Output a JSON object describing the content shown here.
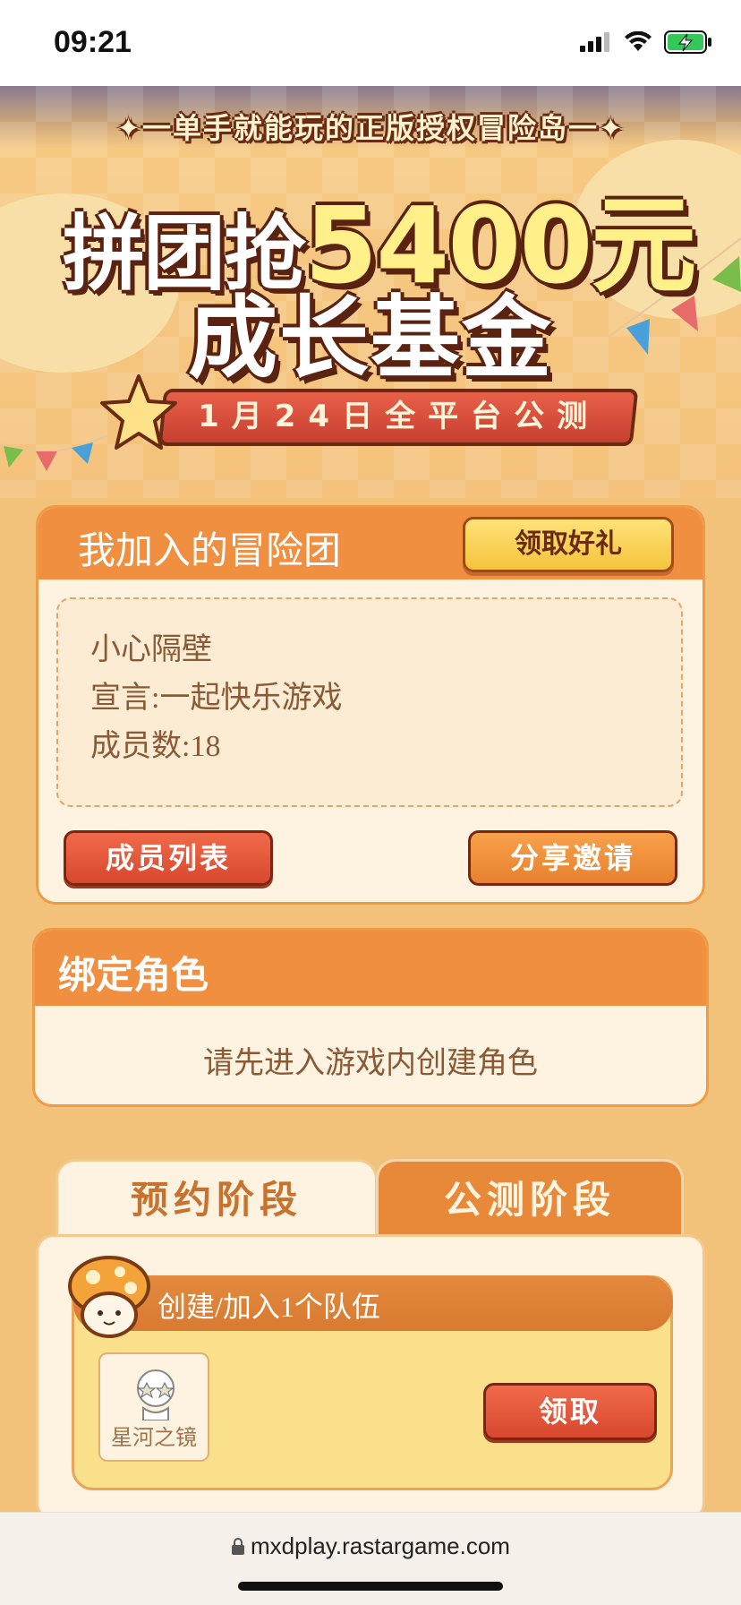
{
  "status_bar": {
    "time": "09:21"
  },
  "hero": {
    "tagline": "✦一单手就能玩的正版授权冒险岛一✦",
    "headline_part1": "拼团抢",
    "headline_part2": "5400元",
    "headline_line2": "成长基金",
    "date_ribbon": "1月24日全平台公测"
  },
  "my_team": {
    "title": "我加入的冒险团",
    "claim_button": "领取好礼",
    "team_name": "小心隔壁",
    "motto": "宣言:一起快乐游戏",
    "members": "成员数:18",
    "member_list_button": "成员列表",
    "share_button": "分享邀请"
  },
  "bind_role": {
    "title": "绑定角色",
    "message": "请先进入游戏内创建角色"
  },
  "tabs": [
    {
      "label": "预约阶段",
      "active": true
    },
    {
      "label": "公测阶段",
      "active": false
    }
  ],
  "task": {
    "title": "创建/加入1个队伍",
    "reward_name": "星河之镜",
    "claim_button": "领取"
  },
  "browser": {
    "url": "mxdplay.rastargame.com"
  },
  "colors": {
    "page_bg": "#f3c27a",
    "panel_header": "#ef8f3f",
    "panel_body": "#fdf3e0",
    "gold_button": "#f5c33c",
    "red_button": "#d8482f",
    "text_brown": "#8a5a36"
  }
}
